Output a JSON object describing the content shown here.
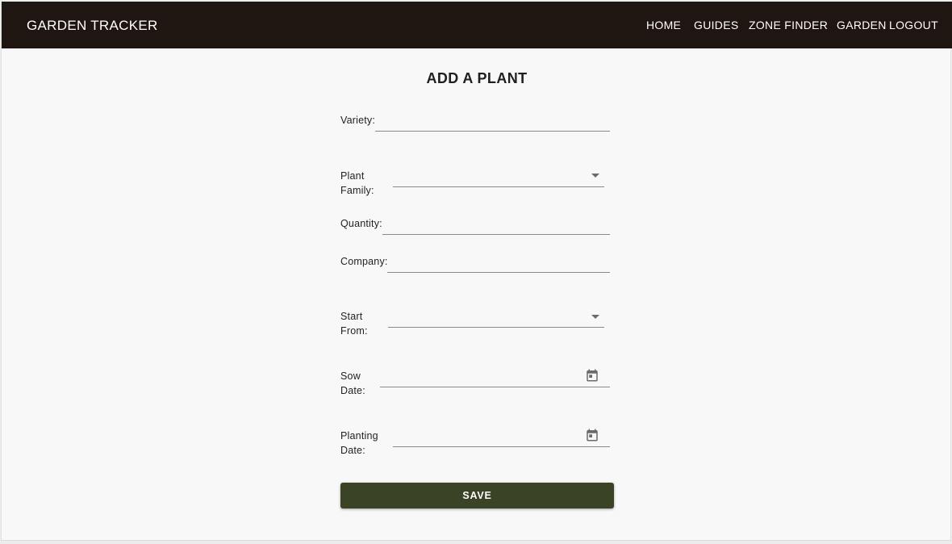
{
  "app": {
    "title": "GARDEN TRACKER"
  },
  "nav": {
    "home": "HOME",
    "guides": "GUIDES",
    "zone_finder": "ZONE FINDER",
    "garden": "GARDEN",
    "logout": "LOGOUT"
  },
  "page": {
    "title": "ADD A PLANT"
  },
  "form": {
    "variety": {
      "label": "Variety:",
      "value": ""
    },
    "plant_family": {
      "label_line1": "Plant",
      "label_line2": "Family:",
      "selected": "",
      "icon": "chevron-down-icon"
    },
    "quantity": {
      "label": "Quantity:",
      "value": ""
    },
    "company": {
      "label": "Company:",
      "value": ""
    },
    "start_from": {
      "label_line1": "Start",
      "label_line2": "From:",
      "selected": "",
      "icon": "chevron-down-icon"
    },
    "sow_date": {
      "label_line1": "Sow",
      "label_line2": "Date:",
      "value": "",
      "icon": "calendar-icon"
    },
    "planting_date": {
      "label_line1": "Planting",
      "label_line2": "Date:",
      "value": "",
      "icon": "calendar-icon"
    },
    "save_label": "SAVE"
  },
  "colors": {
    "appbar": "#201611",
    "page_background": "#f8f8f8",
    "save_button": "#3b4326",
    "text": "#222222"
  }
}
